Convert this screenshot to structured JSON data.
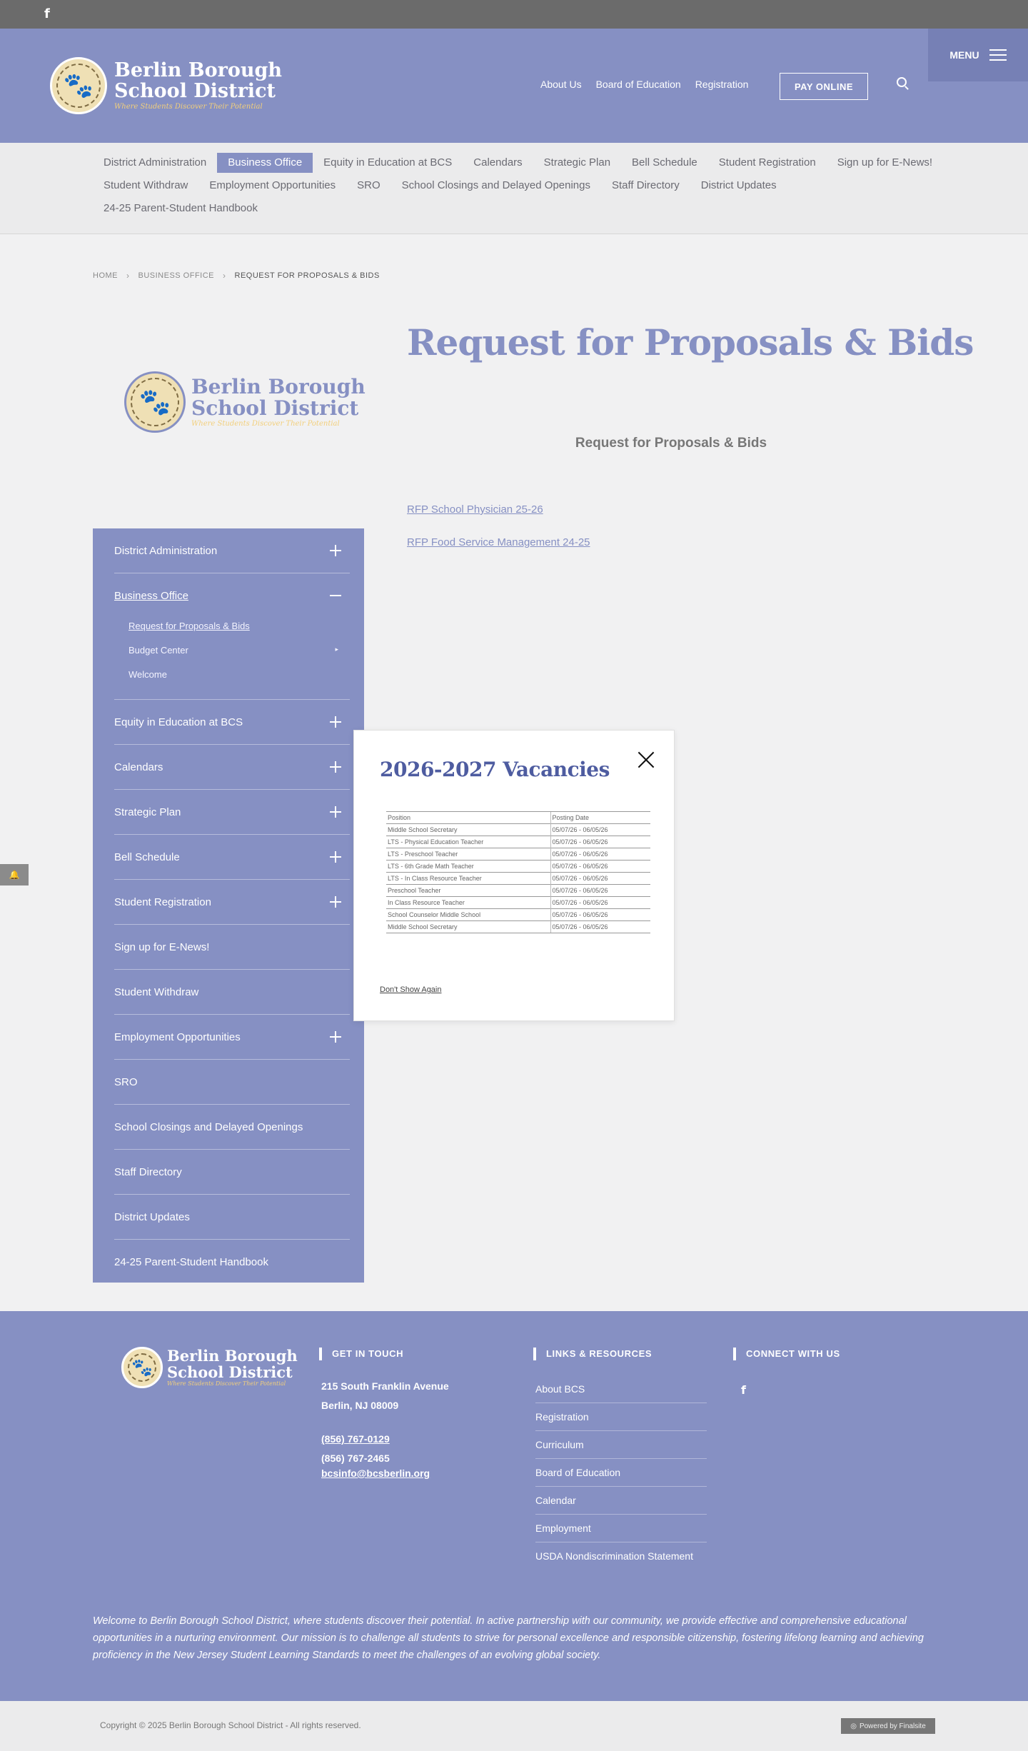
{
  "topbar": {
    "facebook_glyph": "f"
  },
  "brand": {
    "line1": "Berlin Borough",
    "line2": "School District",
    "tagline": "Where Students Discover Their Potential",
    "accent_color": "#8690c3",
    "gold_color": "#f2cf7b"
  },
  "header": {
    "links": [
      "About Us",
      "Board of Education",
      "Registration"
    ],
    "pay_label": "PAY ONLINE",
    "menu_label": "MENU"
  },
  "hnav": {
    "items": [
      "District Administration",
      "Business Office",
      "Equity in Education at BCS",
      "Calendars",
      "Strategic Plan",
      "Bell Schedule",
      "Student Registration",
      "Sign up for E-News!",
      "Student Withdraw",
      "Employment Opportunities",
      "SRO",
      "School Closings and Delayed Openings",
      "Staff Directory",
      "District Updates",
      "24-25 Parent-Student Handbook"
    ],
    "active": "Business Office"
  },
  "breadcrumb": {
    "home": "HOME",
    "parent": "BUSINESS OFFICE",
    "current": "REQUEST FOR PROPOSALS & BIDS"
  },
  "page": {
    "title": "Request for Proposals & Bids",
    "subhead": "Request for Proposals & Bids",
    "links": [
      "RFP School Physician 25-26",
      "RFP Food Service Management 24-25"
    ]
  },
  "sidebar": {
    "items": [
      "District Administration",
      "Business Office",
      "Equity in Education at BCS",
      "Calendars",
      "Strategic Plan",
      "Bell Schedule",
      "Student Registration",
      "Sign up for E-News!",
      "Student Withdraw",
      "Employment Opportunities",
      "SRO",
      "School Closings and Delayed Openings",
      "Staff Directory",
      "District Updates",
      "24-25 Parent-Student Handbook"
    ],
    "sub_items": [
      "Request for Proposals & Bids",
      "Budget Center",
      "Welcome"
    ]
  },
  "popup": {
    "title": "2026-2027 Vacancies",
    "col_position": "Position",
    "col_date": "Posting Date",
    "rows": [
      [
        "Middle School Secretary",
        "05/07/26 - 06/05/26"
      ],
      [
        "LTS - Physical Education Teacher",
        "05/07/26 - 06/05/26"
      ],
      [
        "LTS - Preschool Teacher",
        "05/07/26 - 06/05/26"
      ],
      [
        "LTS - 6th Grade Math Teacher",
        "05/07/26 - 06/05/26"
      ],
      [
        "LTS - In Class Resource Teacher",
        "05/07/26 - 06/05/26"
      ],
      [
        "Preschool Teacher",
        "05/07/26 - 06/05/26"
      ],
      [
        "In Class Resource Teacher",
        "05/07/26 - 06/05/26"
      ],
      [
        "School Counselor Middle School",
        "05/07/26 - 06/05/26"
      ],
      [
        "Middle School Secretary",
        "05/07/26 - 06/05/26"
      ]
    ],
    "dont_show": "Don't Show Again"
  },
  "footer": {
    "get_in_touch": "GET IN TOUCH",
    "address1": "215 South Franklin Avenue",
    "address2": "Berlin, NJ  08009",
    "phone": "(856) 767-0129",
    "fax": "(856) 767-2465",
    "email": "bcsinfo@bcsberlin.org",
    "links_head": "LINKS & RESOURCES",
    "links": [
      "About BCS",
      "Registration",
      "Curriculum",
      "Board of Education",
      "Calendar",
      "Employment",
      "USDA Nondiscrimination Statement"
    ],
    "connect_head": "CONNECT WITH US",
    "mission": "Welcome to Berlin Borough School District, where students discover their potential. In active partnership with our community, we provide effective and comprehensive educational opportunities in a nurturing environment. Our mission is to challenge all students to strive for personal excellence and responsible citizenship, fostering lifelong learning and achieving proficiency in the New Jersey Student Learning Standards to meet the challenges of an evolving global society.",
    "copyright": "Copyright © 2025 Berlin Borough School District - All rights reserved.",
    "powered_by": "Powered by Finalsite"
  }
}
